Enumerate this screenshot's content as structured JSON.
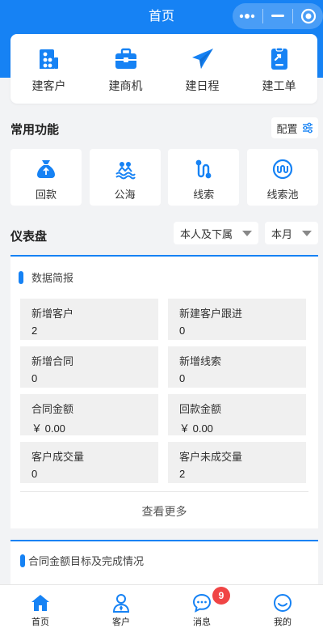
{
  "header": {
    "title": "首页"
  },
  "quick_actions": [
    {
      "label": "建客户",
      "icon": "building-icon"
    },
    {
      "label": "建商机",
      "icon": "briefcase-icon"
    },
    {
      "label": "建日程",
      "icon": "paper-plane-icon"
    },
    {
      "label": "建工单",
      "icon": "ticket-icon"
    }
  ],
  "common": {
    "title": "常用功能",
    "config_label": "配置",
    "items": [
      {
        "label": "回款",
        "icon": "money-bag-icon"
      },
      {
        "label": "公海",
        "icon": "waves-icon"
      },
      {
        "label": "线索",
        "icon": "clue-path-icon"
      },
      {
        "label": "线索池",
        "icon": "clue-pool-icon"
      }
    ]
  },
  "dashboard": {
    "title": "仪表盘",
    "scope_select": "本人及下属",
    "period_select": "本月"
  },
  "summary": {
    "title": "数据简报",
    "stats": [
      {
        "label": "新增客户",
        "value": "2"
      },
      {
        "label": "新建客户跟进",
        "value": "0"
      },
      {
        "label": "新增合同",
        "value": "0"
      },
      {
        "label": "新增线索",
        "value": "0"
      },
      {
        "label": "合同金额",
        "value": "￥ 0.00"
      },
      {
        "label": "回款金额",
        "value": "￥ 0.00"
      },
      {
        "label": "客户成交量",
        "value": "0"
      },
      {
        "label": "客户未成交量",
        "value": "2"
      }
    ],
    "more_label": "查看更多"
  },
  "contract_panel": {
    "title": "合同金额目标及完成情况"
  },
  "tabbar": {
    "items": [
      {
        "label": "首页",
        "icon": "home-icon"
      },
      {
        "label": "客户",
        "icon": "person-icon"
      },
      {
        "label": "消息",
        "icon": "chat-icon",
        "badge": "9"
      },
      {
        "label": "我的",
        "icon": "smile-icon"
      }
    ]
  },
  "colors": {
    "primary": "#1682f4",
    "badge": "#f04545",
    "background": "#f2f3f5"
  }
}
